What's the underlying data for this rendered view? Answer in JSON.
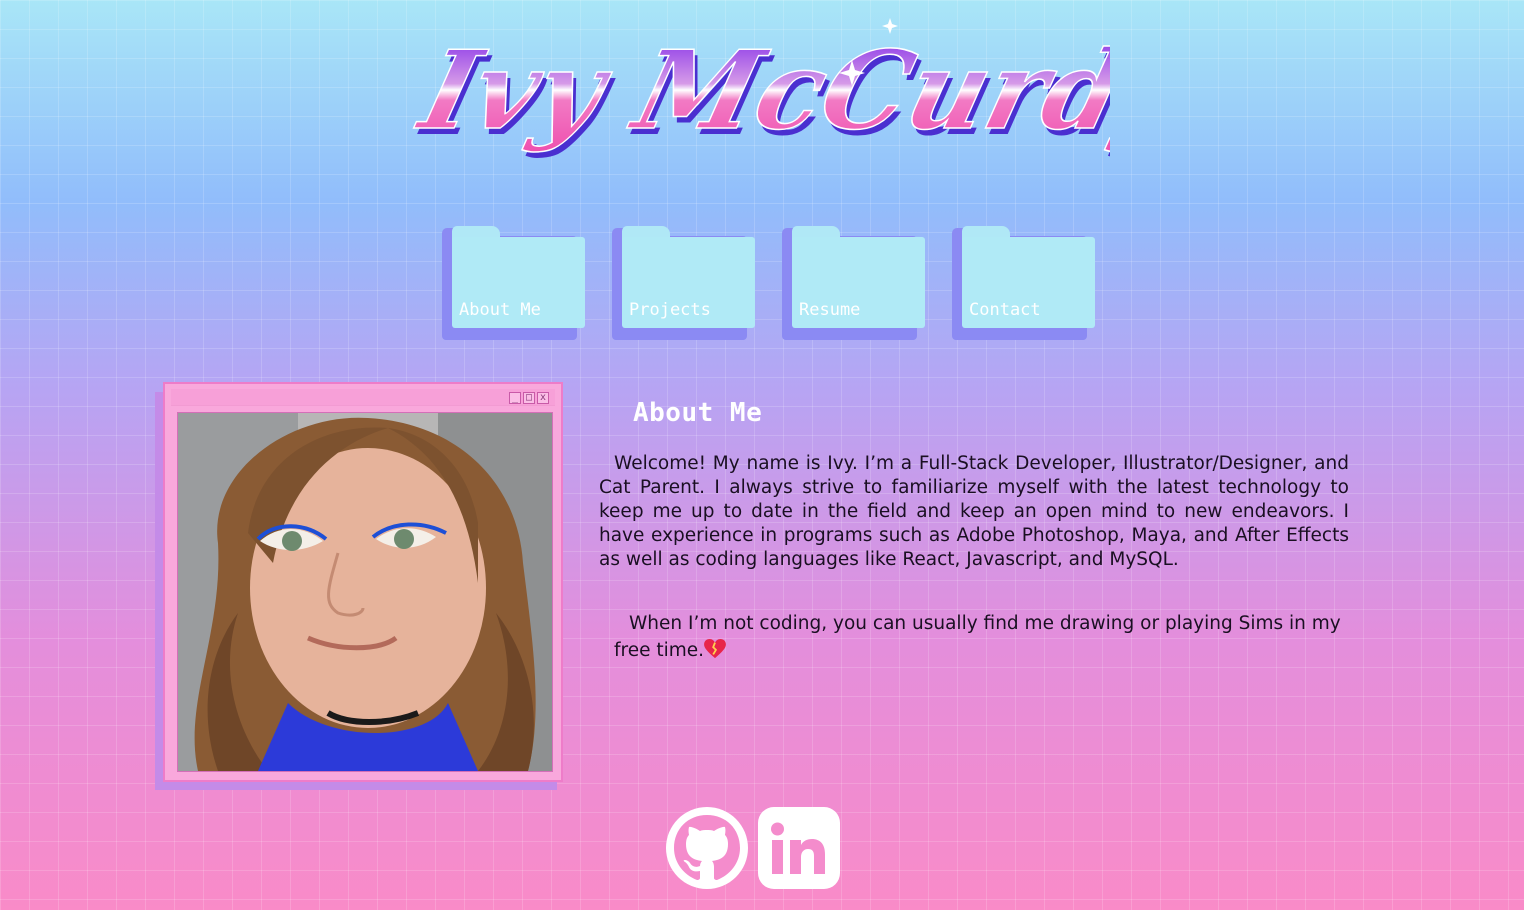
{
  "logo": {
    "text": "Ivy McCurdy"
  },
  "nav": {
    "items": [
      {
        "label": "About Me"
      },
      {
        "label": "Projects"
      },
      {
        "label": "Resume"
      },
      {
        "label": "Contact"
      }
    ]
  },
  "photo_window": {
    "buttons": [
      "_",
      "□",
      "x"
    ]
  },
  "about": {
    "title": "About Me",
    "paragraph_1": "Welcome! My name is Ivy. I’m a Full-Stack Developer, Illustrator/Designer, and Cat Parent. I always strive to familiarize myself with the latest technology to keep me up to date in the field and keep an open mind to new endeavors. I have experience in programs such as Adobe Photoshop, Maya, and After Effects as well as coding languages like React, Javascript, and MySQL.",
    "paragraph_2": "When I’m not coding, you can usually find me drawing or playing Sims in my free time."
  },
  "social": {
    "icons": [
      "github-icon",
      "linkedin-icon"
    ],
    "linkedin_text": "in"
  },
  "colors": {
    "folder": "#b0eaf6",
    "folder_shadow": "#8b8af3",
    "window": "#f9a8dc",
    "logo_pink": "#f054b4",
    "logo_purple": "#7a22e8"
  }
}
